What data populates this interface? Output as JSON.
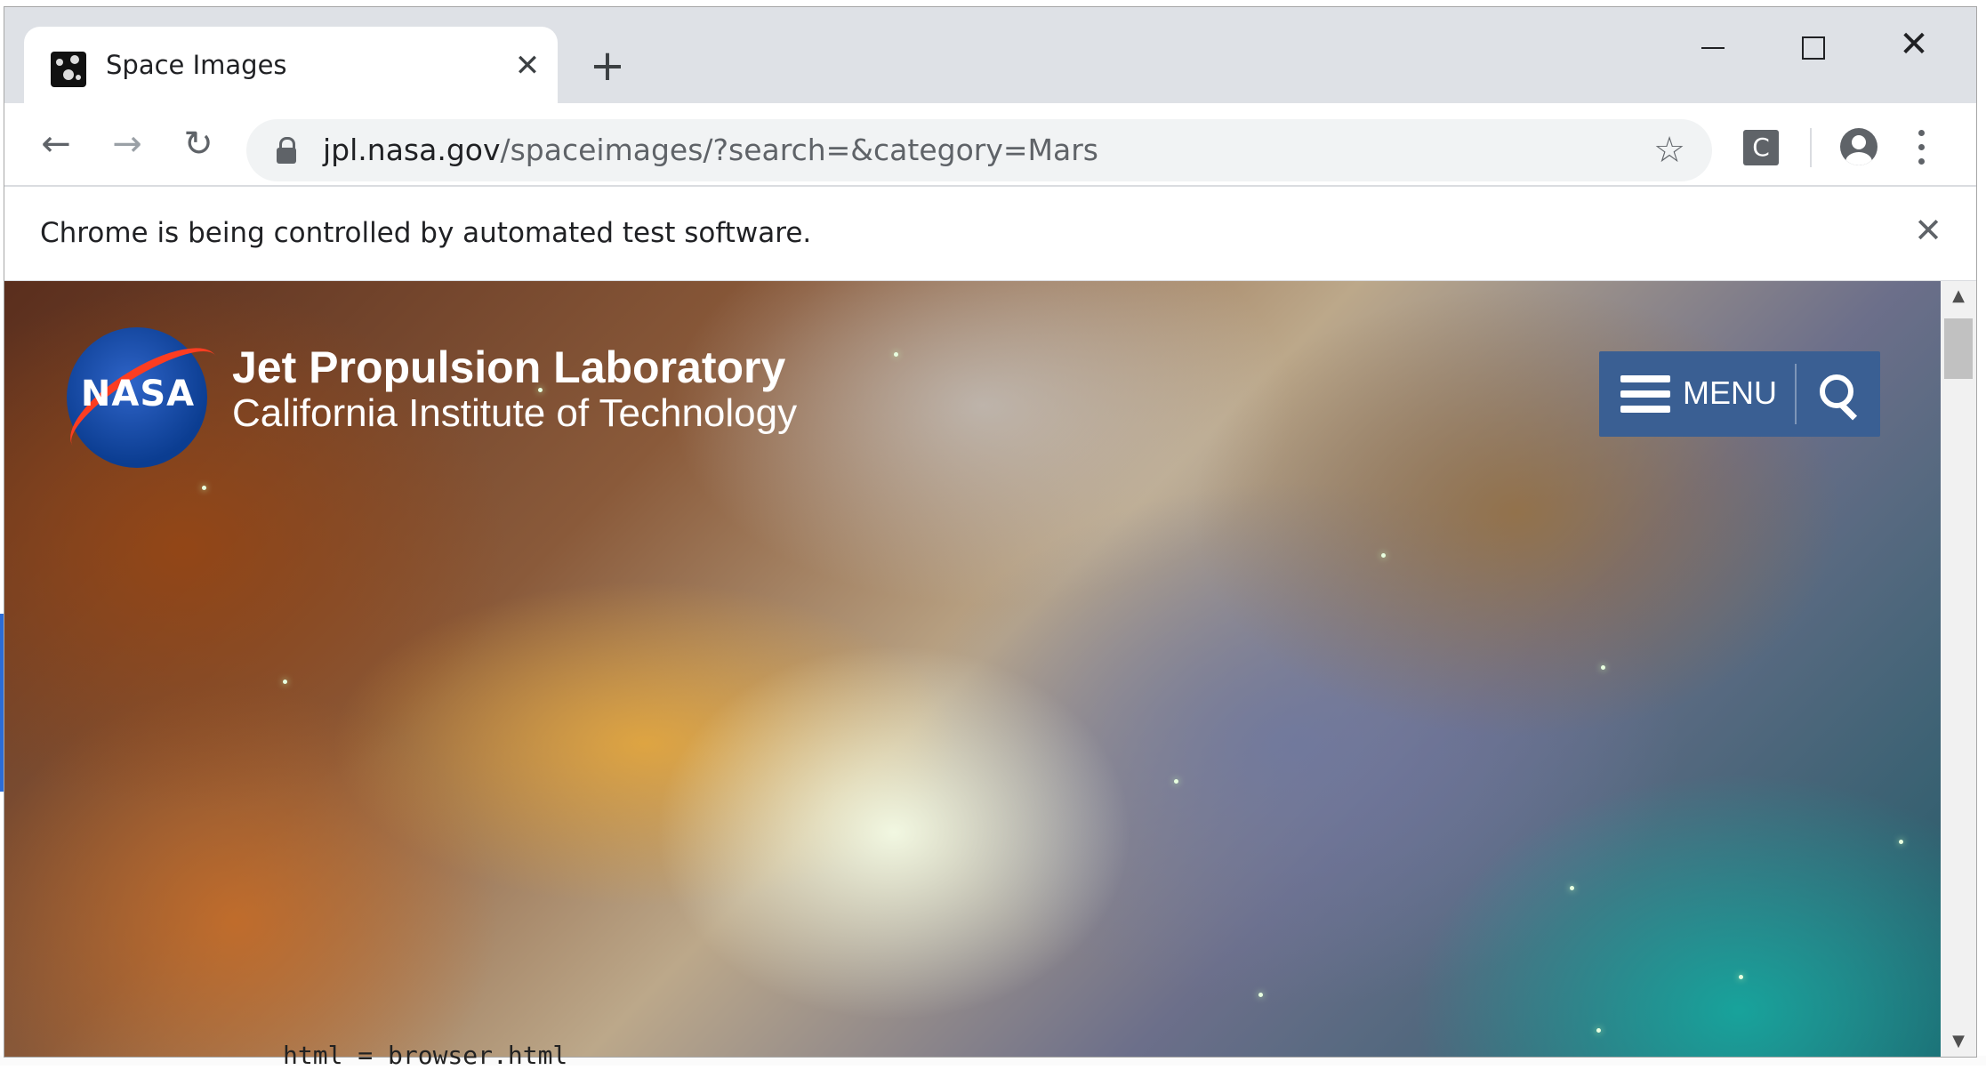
{
  "browser": {
    "tab_title": "Space Images",
    "tab_close": "✕",
    "new_tab": "+",
    "window_close": "✕",
    "url_domain": "jpl.nasa.gov",
    "url_path": "/spaceimages/?search=&category=Mars",
    "back": "←",
    "forward": "→",
    "reload": "↻",
    "bookmark": "☆",
    "extension_label": "C",
    "infobar_text": "Chrome is being controlled by automated test software.",
    "infobar_close": "✕"
  },
  "page": {
    "logo_text": "NASA",
    "title": "Jet Propulsion Laboratory",
    "subtitle": "California Institute of Technology",
    "menu_label": "MENU"
  },
  "scrollbar": {
    "up": "▲",
    "down": "▼"
  },
  "background": {
    "code_snippet": "html = browser.html"
  },
  "colors": {
    "menu_bg": "#3a5f93",
    "chrome_frame": "#dee1e6",
    "nasa_blue": "#0b3d91",
    "nasa_red": "#fc3d21"
  },
  "icons": [
    "favicon",
    "close-icon",
    "plus-icon",
    "minimize-icon",
    "maximize-icon",
    "back-arrow-icon",
    "forward-arrow-icon",
    "reload-icon",
    "lock-icon",
    "star-icon",
    "extension-icon",
    "profile-icon",
    "more-vert-icon",
    "hamburger-icon",
    "search-icon"
  ]
}
